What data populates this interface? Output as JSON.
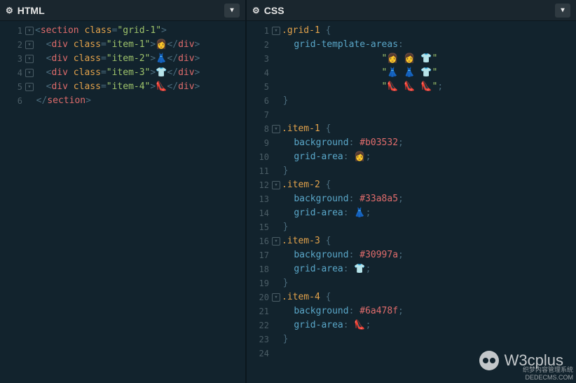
{
  "panes": {
    "html": {
      "title": "HTML"
    },
    "css": {
      "title": "CSS"
    }
  },
  "emoji": {
    "girl": "👩",
    "dress": "👗",
    "shirt": "👕",
    "shoe": "👠"
  },
  "html_code": {
    "section_open_tag": "section",
    "section_attr": "class",
    "section_class": "grid-1",
    "div_tag": "div",
    "div_attr": "class",
    "items": [
      {
        "cls": "item-1",
        "emoji_key": "girl"
      },
      {
        "cls": "item-2",
        "emoji_key": "dress"
      },
      {
        "cls": "item-3",
        "emoji_key": "shirt"
      },
      {
        "cls": "item-4",
        "emoji_key": "shoe"
      }
    ],
    "section_close": "section"
  },
  "css_code": {
    "grid_selector": ".grid-1",
    "grid_prop": "grid-template-areas",
    "grid_rows": [
      [
        "girl",
        "girl",
        "shirt"
      ],
      [
        "dress",
        "dress",
        "shirt"
      ],
      [
        "shoe",
        "shoe",
        "shoe"
      ]
    ],
    "items": [
      {
        "sel": ".item-1",
        "bg": "#b03532",
        "area_key": "girl"
      },
      {
        "sel": ".item-2",
        "bg": "#33a8a5",
        "area_key": "dress"
      },
      {
        "sel": ".item-3",
        "bg": "#30997a",
        "area_key": "shirt"
      },
      {
        "sel": ".item-4",
        "bg": "#6a478f",
        "area_key": "shoe"
      }
    ],
    "prop_bg": "background",
    "prop_area": "grid-area"
  },
  "watermark": "W3cplus",
  "corner": [
    "织梦内容管理系统",
    "DEDECMS.COM"
  ]
}
